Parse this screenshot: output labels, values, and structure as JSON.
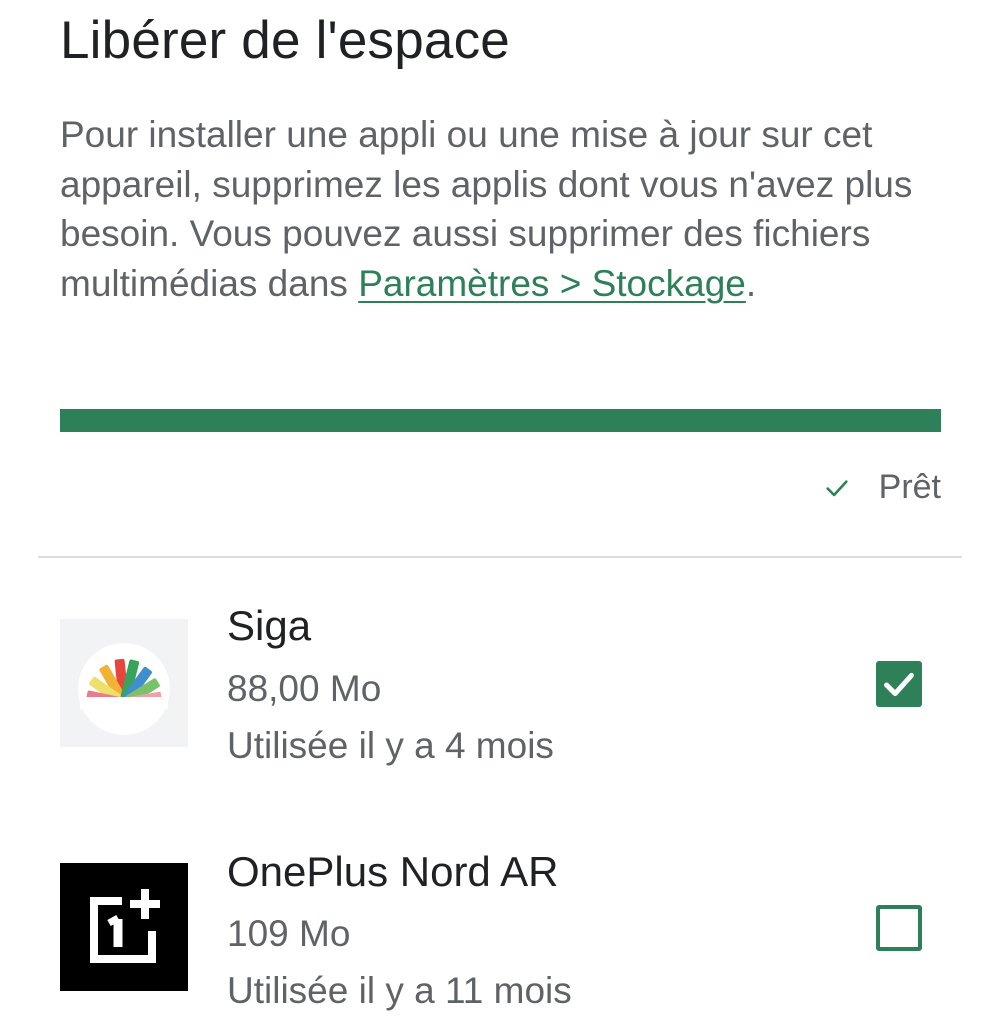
{
  "page": {
    "title": "Libérer de l'espace",
    "description": "Pour installer une appli ou une mise à jour sur cet appareil, supprimez les applis dont vous n'avez plus besoin. Vous pouvez aussi supprimer des fichiers multimédias dans ",
    "settings_link": "Paramètres > Stockage",
    "description_end": "."
  },
  "progress": {
    "fraction": 1.0
  },
  "status": {
    "icon": "check-icon",
    "label": "Prêt"
  },
  "apps": [
    {
      "name": "Siga",
      "size": "88,00 Mo",
      "last_used": "Utilisée il y a 4 mois",
      "icon": "siga-app-icon",
      "selected": true
    },
    {
      "name": "OnePlus Nord AR",
      "size": "109 Mo",
      "last_used": "Utilisée il y a 11 mois",
      "icon": "oneplus-app-icon",
      "selected": false
    }
  ],
  "colors": {
    "accent": "#2e8058",
    "text_primary": "#202124",
    "text_secondary": "#5f6368",
    "divider": "#dadce0"
  }
}
